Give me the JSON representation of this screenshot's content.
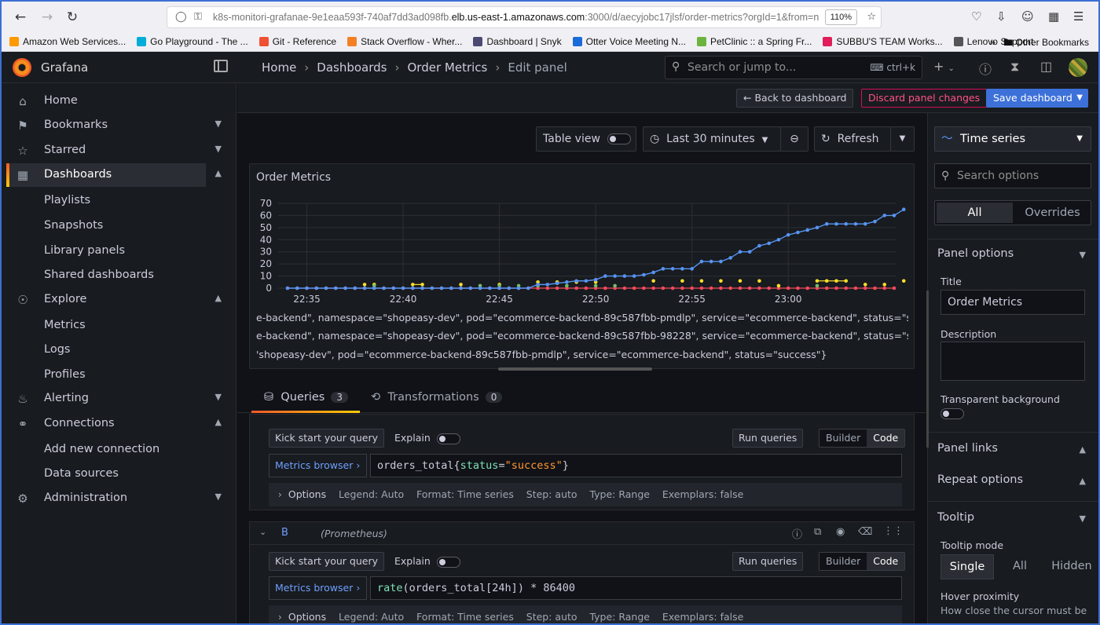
{
  "browser": {
    "url_prefix": "k8s-monitori-grafanae-9e1eaa593f-740af7dd3ad098fb.",
    "url_host": "elb.us-east-1.amazonaws.com",
    "url_suffix": ":3000/d/aecyjobc17jlsf/order-metrics?orgId=1&from=n",
    "zoom": "110%",
    "bookmarks": [
      {
        "label": "Amazon Web Services...",
        "color": "#ff9900"
      },
      {
        "label": "Go Playground - The ...",
        "color": "#00add8"
      },
      {
        "label": "Git - Reference",
        "color": "#f05133"
      },
      {
        "label": "Stack Overflow - Wher...",
        "color": "#f48024"
      },
      {
        "label": "Dashboard | Snyk",
        "color": "#4c4a73"
      },
      {
        "label": "Otter Voice Meeting N...",
        "color": "#1a6bd9"
      },
      {
        "label": "PetClinic :: a Spring Fr...",
        "color": "#6db33f"
      },
      {
        "label": "SUBBU'S TEAM Works...",
        "color": "#e01e5a"
      },
      {
        "label": "Lenovo Support",
        "color": "#555555"
      }
    ],
    "other_bookmarks": "Other Bookmarks"
  },
  "grafana": {
    "brand": "Grafana",
    "breadcrumbs": [
      "Home",
      "Dashboards",
      "Order Metrics",
      "Edit panel"
    ],
    "search_placeholder": "Search or jump to...",
    "search_shortcut": "ctrl+k"
  },
  "sidebar": {
    "items": [
      {
        "label": "Home",
        "icon": "home-icon"
      },
      {
        "label": "Bookmarks",
        "icon": "bookmark-icon"
      },
      {
        "label": "Starred",
        "icon": "star-icon"
      },
      {
        "label": "Dashboards",
        "icon": "apps-icon"
      },
      {
        "label": "Explore",
        "icon": "compass-icon"
      },
      {
        "label": "Alerting",
        "icon": "bell-icon"
      },
      {
        "label": "Connections",
        "icon": "plug-icon"
      },
      {
        "label": "Administration",
        "icon": "cog-icon"
      }
    ],
    "dashboards_sub": [
      "Playlists",
      "Snapshots",
      "Library panels",
      "Shared dashboards"
    ],
    "explore_sub": [
      "Metrics",
      "Logs",
      "Profiles"
    ],
    "connections_sub": [
      "Add new connection",
      "Data sources"
    ]
  },
  "actions": {
    "back": "Back to dashboard",
    "discard": "Discard panel changes",
    "save": "Save dashboard"
  },
  "panel_toolbar": {
    "table_view": "Table view",
    "time_range": "Last 30 minutes",
    "refresh": "Refresh"
  },
  "panel": {
    "title": "Order Metrics",
    "legend": [
      "e-backend\", namespace=\"shopeasy-dev\", pod=\"ecommerce-backend-89c587fbb-pmdlp\", service=\"ecommerce-backend\", status=\"success\"}",
      "e-backend\", namespace=\"shopeasy-dev\", pod=\"ecommerce-backend-89c587fbb-98228\", service=\"ecommerce-backend\", status=\"success\"}",
      "'shopeasy-dev\", pod=\"ecommerce-backend-89c587fbb-pmdlp\", service=\"ecommerce-backend\", status=\"success\"}"
    ]
  },
  "chart_data": {
    "type": "line",
    "title": "Order Metrics",
    "xlabel": "",
    "ylabel": "",
    "ylim": [
      0,
      70
    ],
    "yticks": [
      0,
      10,
      20,
      30,
      40,
      50,
      60,
      70
    ],
    "xticks": [
      "22:35",
      "22:40",
      "22:45",
      "22:50",
      "22:55",
      "23:00"
    ],
    "x": [
      "22:34",
      "22:34:30",
      "22:35",
      "22:35:30",
      "22:36",
      "22:36:30",
      "22:37",
      "22:37:30",
      "22:38",
      "22:38:30",
      "22:39",
      "22:39:30",
      "22:40",
      "22:40:30",
      "22:41",
      "22:41:30",
      "22:42",
      "22:42:30",
      "22:43",
      "22:43:30",
      "22:44",
      "22:44:30",
      "22:45",
      "22:45:30",
      "22:46",
      "22:46:30",
      "22:47",
      "22:47:30",
      "22:48",
      "22:48:30",
      "22:49",
      "22:49:30",
      "22:50",
      "22:50:30",
      "22:51",
      "22:51:30",
      "22:52",
      "22:52:30",
      "22:53",
      "22:53:30",
      "22:54",
      "22:54:30",
      "22:55",
      "22:55:30",
      "22:56",
      "22:56:30",
      "22:57",
      "22:57:30",
      "22:58",
      "22:58:30",
      "22:59",
      "22:59:30",
      "23:00",
      "23:00:30",
      "23:01",
      "23:01:30",
      "23:02",
      "23:02:30",
      "23:03",
      "23:03:30",
      "23:04",
      "23:04:30",
      "23:05",
      "23:05:30"
    ],
    "series": [
      {
        "color": "#5794f2",
        "values": [
          0,
          0,
          0,
          0,
          0,
          0,
          0,
          0,
          0,
          0,
          0,
          0,
          0,
          0,
          0,
          0,
          0,
          0,
          0,
          0,
          0,
          0,
          0,
          0,
          0,
          0,
          3,
          3,
          4,
          5,
          6,
          6,
          7,
          10,
          10,
          10,
          10,
          11,
          13,
          16,
          16,
          16,
          16,
          22,
          22,
          22,
          25,
          30,
          30,
          35,
          37,
          40,
          44,
          46,
          48,
          50,
          53,
          53,
          53,
          53,
          53,
          55,
          60,
          60,
          65
        ]
      },
      {
        "color": "#fade2a",
        "values": [
          null,
          null,
          null,
          null,
          null,
          null,
          null,
          null,
          null,
          null,
          null,
          null,
          null,
          null,
          null,
          null,
          null,
          null,
          null,
          null,
          null,
          null,
          null,
          null,
          null,
          null,
          null,
          null,
          null,
          null,
          null,
          null,
          null,
          null,
          null,
          null,
          null,
          null,
          null,
          null,
          null,
          null,
          null,
          null,
          null,
          null,
          null,
          null,
          null,
          null,
          null,
          null,
          null,
          null,
          null,
          null,
          null,
          null,
          null,
          null,
          null,
          null,
          null,
          null,
          null
        ]
      },
      {
        "color": "#73bf69",
        "values": [
          null
        ]
      },
      {
        "color": "#f2495c",
        "values": [
          0
        ]
      }
    ]
  },
  "tabs": {
    "queries": "Queries",
    "queries_count": "3",
    "transformations": "Transformations",
    "transformations_count": "0"
  },
  "query_a": {
    "kick_start": "Kick start your query",
    "explain": "Explain",
    "run": "Run queries",
    "builder": "Builder",
    "code_mode": "Code",
    "metrics_browser": "Metrics browser",
    "expr_metric": "orders_total{",
    "expr_label": "status",
    "expr_eq": "=",
    "expr_value": "\"success\"",
    "expr_close": "}",
    "options": "Options",
    "legend": "Legend: Auto",
    "format": "Format: Time series",
    "step": "Step: auto",
    "type": "Type: Range",
    "exemplars": "Exemplars: false"
  },
  "query_b": {
    "ref": "B",
    "datasource": "(Prometheus)",
    "kick_start": "Kick start your query",
    "explain": "Explain",
    "run": "Run queries",
    "builder": "Builder",
    "code_mode": "Code",
    "metrics_browser": "Metrics browser",
    "expr_fn": "rate",
    "expr_rest": "(orders_total[24h]) * 86400",
    "options": "Options",
    "legend": "Legend: Auto",
    "format": "Format: Time series",
    "step": "Step: auto",
    "type": "Type: Range",
    "exemplars": "Exemplars: false"
  },
  "options_pane": {
    "visualization": "Time series",
    "search_placeholder": "Search options",
    "tab_all": "All",
    "tab_overrides": "Overrides",
    "panel_options": "Panel options",
    "title_label": "Title",
    "title_value": "Order Metrics",
    "description_label": "Description",
    "transparent_label": "Transparent background",
    "panel_links": "Panel links",
    "repeat_options": "Repeat options",
    "tooltip": "Tooltip",
    "tooltip_mode": "Tooltip mode",
    "mode_single": "Single",
    "mode_all": "All",
    "mode_hidden": "Hidden",
    "hover_proximity": "Hover proximity",
    "hover_desc": "How close the cursor must be"
  }
}
